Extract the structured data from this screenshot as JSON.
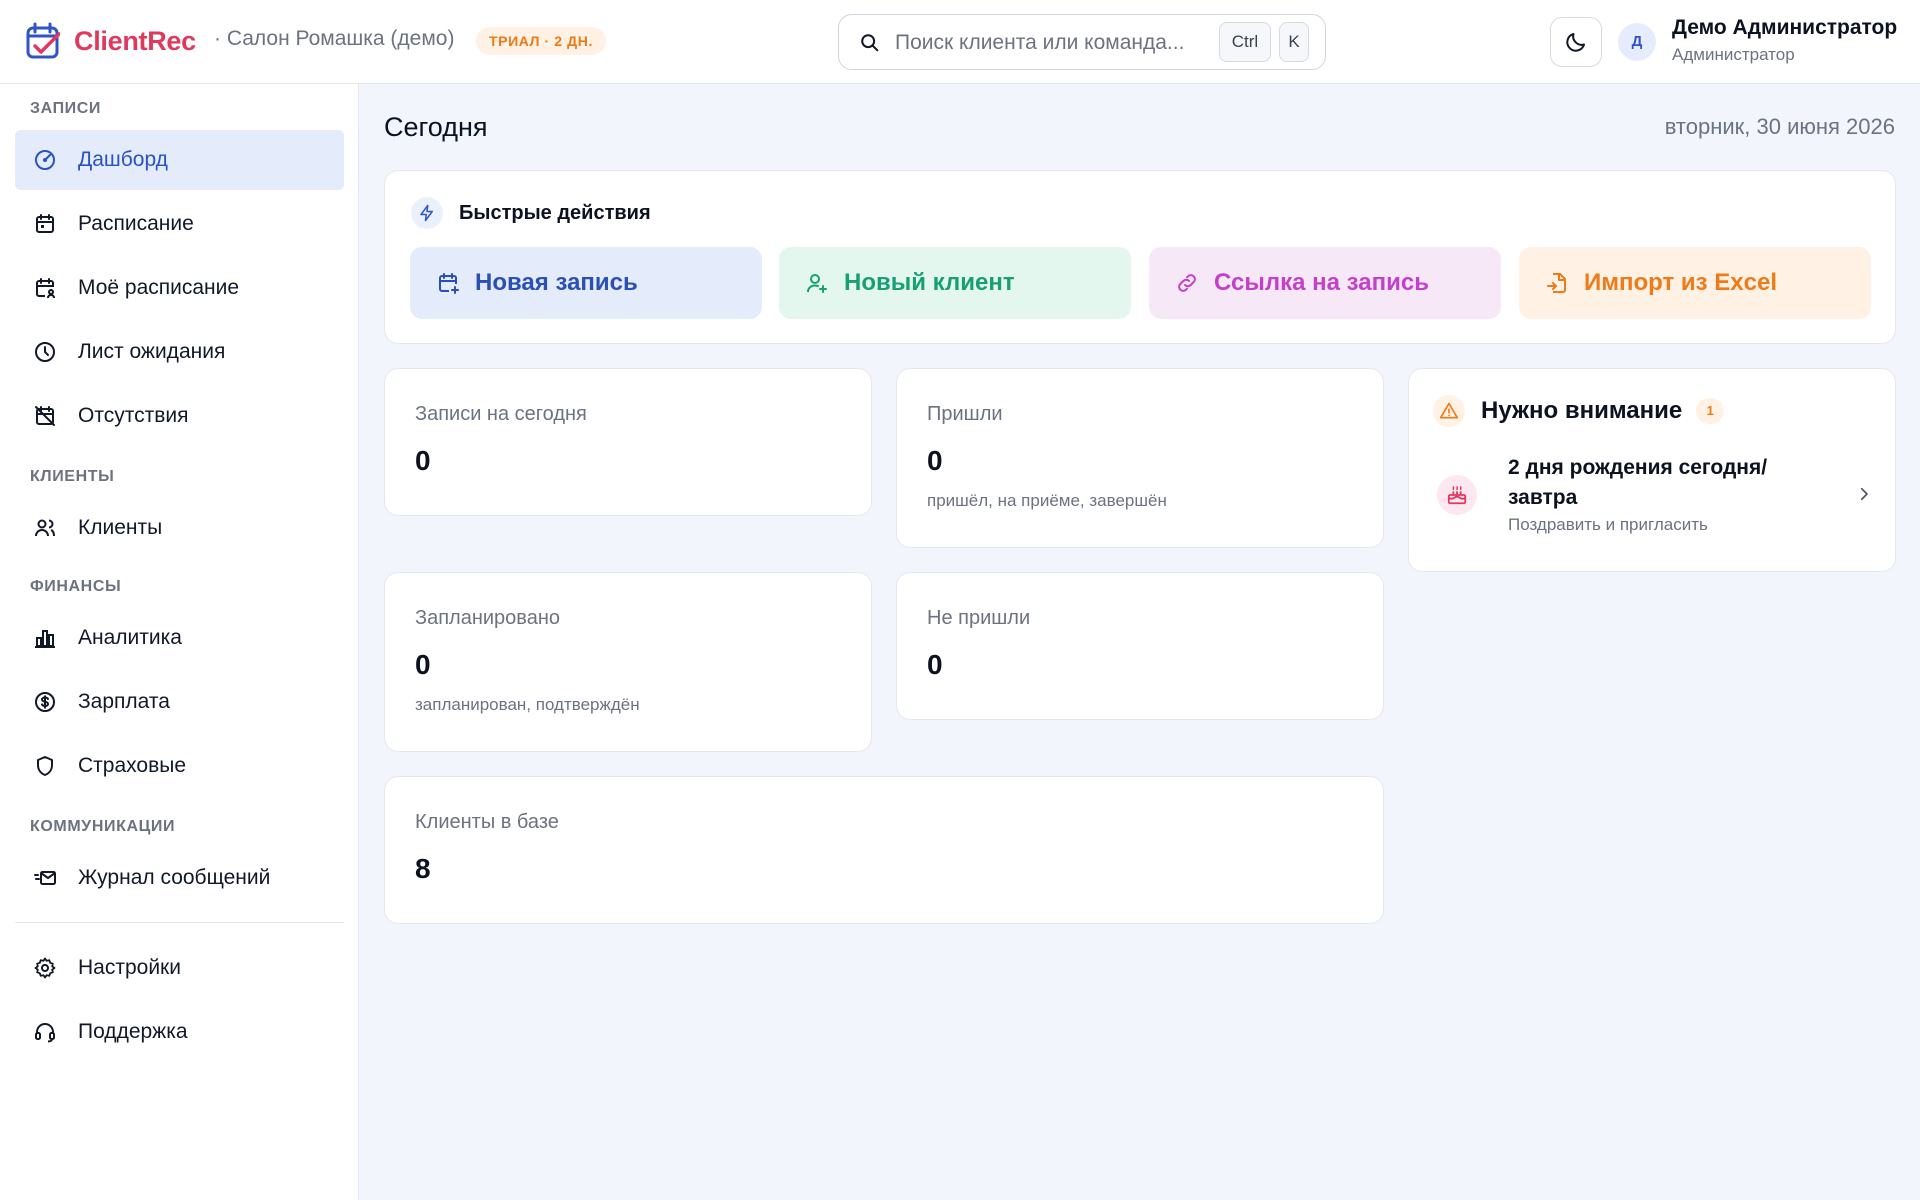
{
  "header": {
    "app_name": "ClientRec",
    "org": "· Салон Ромашка (демо)",
    "trial_badge": "ТРИАЛ · 2 ДН.",
    "search_placeholder": "Поиск клиента или команда...",
    "shortcut_keys": [
      "Ctrl",
      "K"
    ],
    "user": {
      "initial": "Д",
      "name": "Демо Администратор",
      "role": "Администратор"
    }
  },
  "sidebar": {
    "sections": {
      "records": "ЗАПИСИ",
      "clients": "КЛИЕНТЫ",
      "finance": "ФИНАНСЫ",
      "comms": "КОММУНИКАЦИИ"
    },
    "items": [
      {
        "label": "Дашборд",
        "icon": "gauge-icon",
        "active": true
      },
      {
        "label": "Расписание",
        "icon": "calendar-icon"
      },
      {
        "label": "Моё расписание",
        "icon": "calendar-user-icon"
      },
      {
        "label": "Лист ожидания",
        "icon": "clock-icon"
      },
      {
        "label": "Отсутствия",
        "icon": "calendar-off-icon"
      },
      {
        "label": "Клиенты",
        "icon": "users-icon"
      },
      {
        "label": "Аналитика",
        "icon": "bar-chart-icon"
      },
      {
        "label": "Зарплата",
        "icon": "dollar-circle-icon"
      },
      {
        "label": "Страховые",
        "icon": "shield-icon"
      },
      {
        "label": "Журнал сообщений",
        "icon": "mail-fast-icon"
      },
      {
        "label": "Настройки",
        "icon": "gear-icon"
      },
      {
        "label": "Поддержка",
        "icon": "headset-icon"
      }
    ]
  },
  "main": {
    "title": "Сегодня",
    "date": "вторник, 30 июня 2026",
    "quick_actions": {
      "title": "Быстрые действия",
      "buttons": [
        {
          "label": "Новая запись",
          "icon": "calendar-plus-icon",
          "color": "#2a4fb5"
        },
        {
          "label": "Новый клиент",
          "icon": "user-plus-icon",
          "color": "#17a074"
        },
        {
          "label": "Ссылка на запись",
          "icon": "link-icon",
          "color": "#c43fcb"
        },
        {
          "label": "Импорт из Excel",
          "icon": "file-import-icon",
          "color": "#ef7a1a"
        }
      ]
    },
    "stats": {
      "today": {
        "label": "Записи на сегодня",
        "value": "0"
      },
      "arrived": {
        "label": "Пришли",
        "value": "0",
        "sub": "пришёл, на приёме, завершён"
      },
      "planned": {
        "label": "Запланировано",
        "value": "0",
        "sub": "запланирован, подтверждён"
      },
      "noshow": {
        "label": "Не пришли",
        "value": "0"
      },
      "clients": {
        "label": "Клиенты в базе",
        "value": "8"
      }
    },
    "attention": {
      "title": "Нужно внимание",
      "count": "1",
      "item": {
        "title": "2 дня рождения сегодня/завтра",
        "subtitle": "Поздравить и пригласить",
        "icon": "cake-icon"
      }
    }
  },
  "colors": {
    "brand": "#e0395e",
    "accent": "#2a52c5",
    "trial": "#f07812"
  }
}
